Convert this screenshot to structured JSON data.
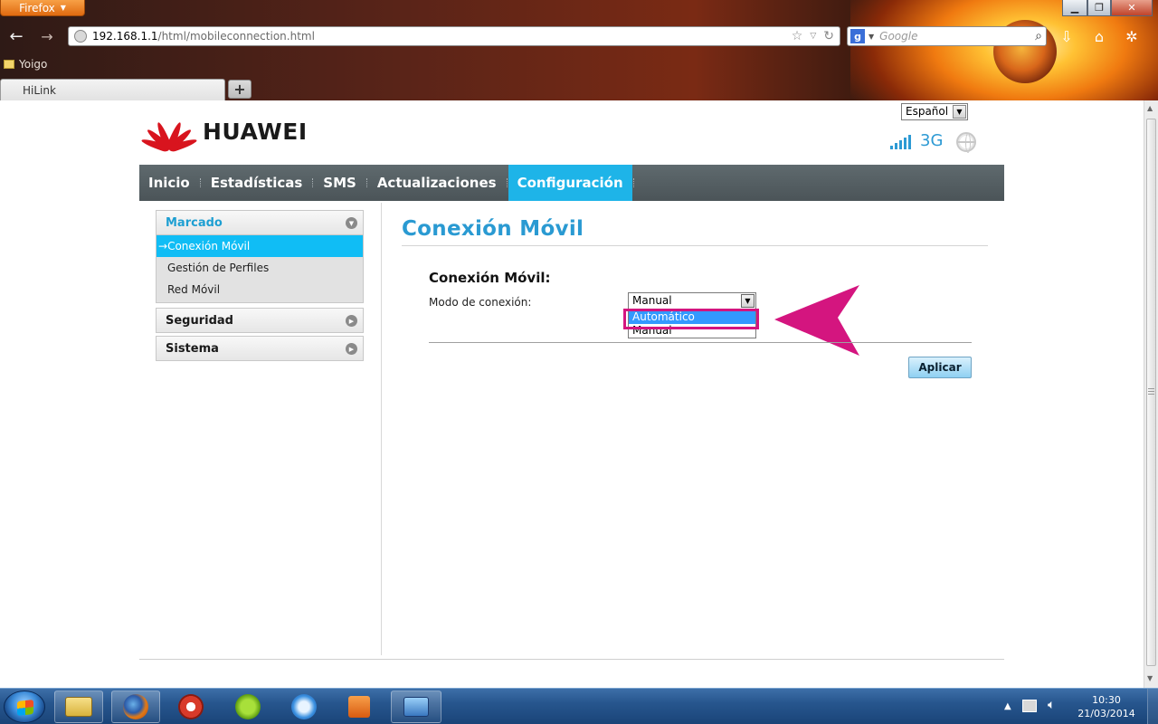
{
  "browser": {
    "menu_button": "Firefox",
    "url_host": "192.168.1.1",
    "url_path": "/html/mobileconnection.html",
    "search_placeholder": "Google",
    "bookmark": "Yoigo",
    "tab_title": "HiLink"
  },
  "header": {
    "brand": "HUAWEI",
    "language": "Español",
    "network_type": "3G",
    "signal_bars": 5
  },
  "nav": {
    "items": [
      {
        "label": "Inicio"
      },
      {
        "label": "Estadísticas"
      },
      {
        "label": "SMS"
      },
      {
        "label": "Actualizaciones"
      },
      {
        "label": "Configuración"
      }
    ],
    "active_index": 4
  },
  "sidebar": {
    "sections": [
      {
        "label": "Marcado",
        "links": [
          "Conexión Móvil",
          "Gestión de Perfiles",
          "Red Móvil"
        ],
        "active_link": "Conexión Móvil"
      },
      {
        "label": "Seguridad"
      },
      {
        "label": "Sistema"
      }
    ],
    "active_prefix": "→"
  },
  "content": {
    "title": "Conexión Móvil",
    "section_heading": "Conexión Móvil:",
    "mode_label": "Modo de conexión:",
    "mode_selected": "Manual",
    "mode_options": [
      "Automático",
      "Manual"
    ],
    "apply_label": "Aplicar"
  },
  "taskbar": {
    "time": "10:30",
    "date": "21/03/2014"
  },
  "colors": {
    "accent_blue": "#1eb4e8",
    "title_blue": "#2a9ad2",
    "highlight_magenta": "#d4157f",
    "huawei_red": "#d8141e"
  }
}
